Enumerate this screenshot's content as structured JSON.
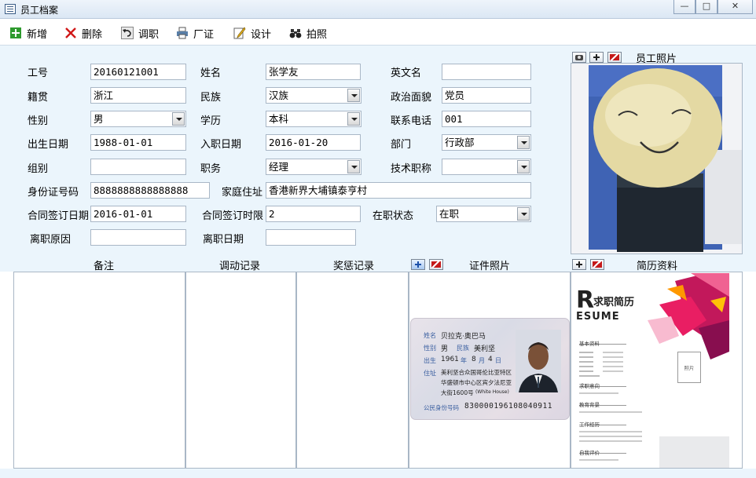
{
  "window": {
    "title": "员工档案",
    "min": "—",
    "max": "□",
    "close": "✕"
  },
  "toolbar": {
    "add": "新增",
    "delete": "删除",
    "transfer": "调职",
    "factory_card": "厂证",
    "design": "设计",
    "photo": "拍照"
  },
  "form": {
    "emp_no": {
      "label": "工号",
      "value": "20160121001"
    },
    "name": {
      "label": "姓名",
      "value": "张学友"
    },
    "english_name": {
      "label": "英文名",
      "value": ""
    },
    "native_place": {
      "label": "籍贯",
      "value": "浙江"
    },
    "ethnicity": {
      "label": "民族",
      "value": "汉族"
    },
    "political": {
      "label": "政治面貌",
      "value": "党员"
    },
    "gender": {
      "label": "性别",
      "value": "男"
    },
    "education": {
      "label": "学历",
      "value": "本科"
    },
    "phone": {
      "label": "联系电话",
      "value": "001"
    },
    "birth_date": {
      "label": "出生日期",
      "value": "1988-01-01"
    },
    "entry_date": {
      "label": "入职日期",
      "value": "2016-01-20"
    },
    "department": {
      "label": "部门",
      "value": "行政部"
    },
    "group": {
      "label": "组别",
      "value": ""
    },
    "position": {
      "label": "职务",
      "value": "经理"
    },
    "tech_title": {
      "label": "技术职称",
      "value": ""
    },
    "id_no": {
      "label": "身份证号码",
      "value": "8888888888888888"
    },
    "address": {
      "label": "家庭住址",
      "value": "香港新界大埔镇泰亨村"
    },
    "contract_date": {
      "label": "合同签订日期",
      "value": "2016-01-01"
    },
    "contract_term": {
      "label": "合同签订时限",
      "value": "2"
    },
    "status": {
      "label": "在职状态",
      "value": "在职"
    },
    "leave_reason": {
      "label": "离职原因",
      "value": ""
    },
    "leave_date": {
      "label": "离职日期",
      "value": ""
    }
  },
  "panels": {
    "photo_title": "员工照片",
    "remarks": "备注",
    "transfer_log": "调动记录",
    "reward_log": "奖惩记录",
    "id_photo": "证件照片",
    "resume": "简历资料"
  },
  "id_card": {
    "name_label": "姓名",
    "name": "贝拉克·奥巴马",
    "gender_label": "性别",
    "gender": "男",
    "ethnicity_label": "民族",
    "ethnicity": "美利坚",
    "birth_label": "出生",
    "birth_year": "1961",
    "year_unit": "年",
    "birth_month": "8",
    "month_unit": "月",
    "birth_day": "4",
    "day_unit": "日",
    "address_label": "住址",
    "address_1": "美利坚合众国哥伦比亚特区",
    "address_2": "华盛顿市中心区宾夕法尼亚",
    "address_3": "大街1600号",
    "address_en": "(White House)",
    "id_label": "公民身份号码",
    "id_no": "830000196108040911"
  },
  "resume": {
    "logo_big": "R",
    "logo_cn": "求职简历",
    "logo_en": "ESUME",
    "section_basic": "基本资料",
    "photo_box": "照片",
    "section_intent": "求职意向",
    "section_edu": "教育背景",
    "section_work": "工作经历",
    "section_self": "自我评价"
  },
  "colors": {
    "form_bg": "#ebf5fc",
    "accent_red": "#c51a1a",
    "add_green": "#2e9a2e"
  }
}
